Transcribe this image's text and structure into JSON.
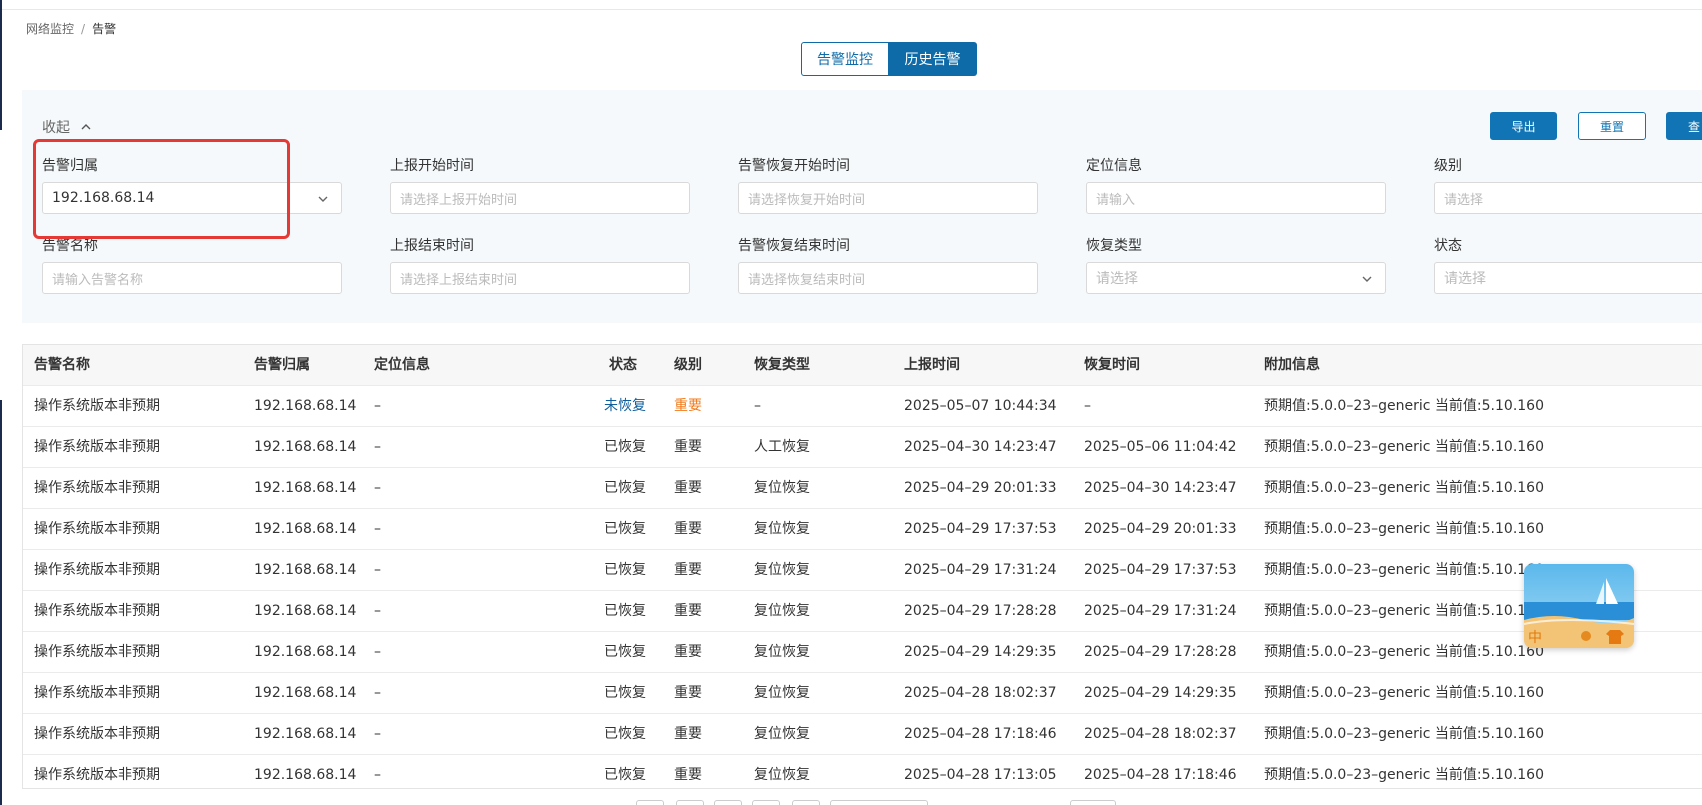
{
  "breadcrumb": {
    "parent": "网络监控",
    "separator": "/",
    "current": "告警"
  },
  "tabs": [
    {
      "label": "告警监控"
    },
    {
      "label": "历史告警",
      "active": true
    }
  ],
  "filters": {
    "collapse_label": "收起",
    "buttons": {
      "export": "导出",
      "reset": "重置",
      "query": "查"
    },
    "fields": {
      "alarm_owner": {
        "label": "告警归属",
        "value": "192.168.68.14"
      },
      "report_start": {
        "label": "上报开始时间",
        "placeholder": "请选择上报开始时间"
      },
      "recover_start": {
        "label": "告警恢复开始时间",
        "placeholder": "请选择恢复开始时间"
      },
      "location": {
        "label": "定位信息",
        "placeholder": "请输入"
      },
      "level": {
        "label": "级别",
        "placeholder": "请选择"
      },
      "alarm_name": {
        "label": "告警名称",
        "placeholder": "请输入告警名称"
      },
      "report_end": {
        "label": "上报结束时间",
        "placeholder": "请选择上报结束时间"
      },
      "recover_end": {
        "label": "告警恢复结束时间",
        "placeholder": "请选择恢复结束时间"
      },
      "recover_type": {
        "label": "恢复类型",
        "placeholder": "请选择"
      },
      "status": {
        "label": "状态",
        "placeholder": "请选择"
      }
    }
  },
  "table": {
    "columns": [
      "告警名称",
      "告警归属",
      "定位信息",
      "状态",
      "级别",
      "恢复类型",
      "上报时间",
      "恢复时间",
      "附加信息"
    ],
    "rows": [
      [
        "操作系统版本非预期",
        "192.168.68.14",
        "–",
        "未恢复",
        "重要",
        "–",
        "2025–05–07 10:44:34",
        "–",
        "预期值:5.0.0–23–generic 当前值:5.10.160"
      ],
      [
        "操作系统版本非预期",
        "192.168.68.14",
        "–",
        "已恢复",
        "重要",
        "人工恢复",
        "2025–04–30 14:23:47",
        "2025–05–06 11:04:42",
        "预期值:5.0.0–23–generic 当前值:5.10.160"
      ],
      [
        "操作系统版本非预期",
        "192.168.68.14",
        "–",
        "已恢复",
        "重要",
        "复位恢复",
        "2025–04–29 20:01:33",
        "2025–04–30 14:23:47",
        "预期值:5.0.0–23–generic 当前值:5.10.160"
      ],
      [
        "操作系统版本非预期",
        "192.168.68.14",
        "–",
        "已恢复",
        "重要",
        "复位恢复",
        "2025–04–29 17:37:53",
        "2025–04–29 20:01:33",
        "预期值:5.0.0–23–generic 当前值:5.10.160"
      ],
      [
        "操作系统版本非预期",
        "192.168.68.14",
        "–",
        "已恢复",
        "重要",
        "复位恢复",
        "2025–04–29 17:31:24",
        "2025–04–29 17:37:53",
        "预期值:5.0.0–23–generic 当前值:5.10.160"
      ],
      [
        "操作系统版本非预期",
        "192.168.68.14",
        "–",
        "已恢复",
        "重要",
        "复位恢复",
        "2025–04–29 17:28:28",
        "2025–04–29 17:31:24",
        "预期值:5.0.0–23–generic 当前值:5.10.160"
      ],
      [
        "操作系统版本非预期",
        "192.168.68.14",
        "–",
        "已恢复",
        "重要",
        "复位恢复",
        "2025–04–29 14:29:35",
        "2025–04–29 17:28:28",
        "预期值:5.0.0–23–generic 当前值:5.10.160"
      ],
      [
        "操作系统版本非预期",
        "192.168.68.14",
        "–",
        "已恢复",
        "重要",
        "复位恢复",
        "2025–04–28 18:02:37",
        "2025–04–29 14:29:35",
        "预期值:5.0.0–23–generic 当前值:5.10.160"
      ],
      [
        "操作系统版本非预期",
        "192.168.68.14",
        "–",
        "已恢复",
        "重要",
        "复位恢复",
        "2025–04–28 17:18:46",
        "2025–04–28 18:02:37",
        "预期值:5.0.0–23–generic 当前值:5.10.160"
      ],
      [
        "操作系统版本非预期",
        "192.168.68.14",
        "–",
        "已恢复",
        "重要",
        "复位恢复",
        "2025–04–28 17:13:05",
        "2025–04–28 17:18:46",
        "预期值:5.0.0–23–generic 当前值:5.10.160"
      ]
    ]
  },
  "widget": {
    "glyph": "中"
  },
  "colors": {
    "primary": "#1175b5",
    "unrecovered": "#0f5e9c",
    "important_active": "#f07b1d",
    "highlight": "#e53935"
  }
}
